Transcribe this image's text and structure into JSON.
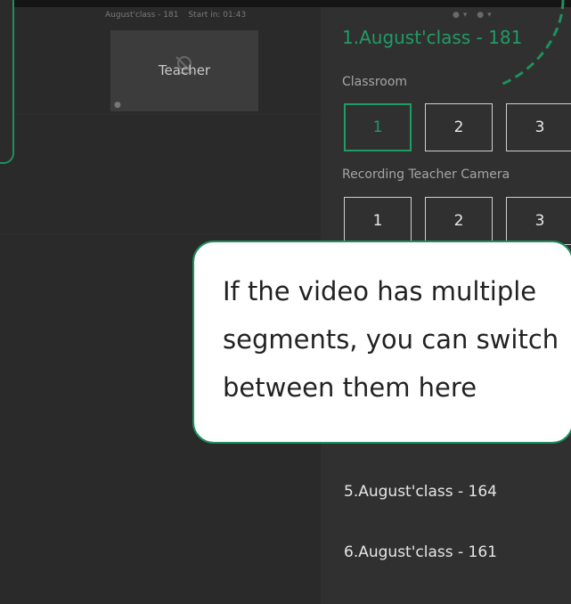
{
  "topbar": {
    "class_name": "August'class - 181",
    "countdown": "Start in: 01:43"
  },
  "video_tile": {
    "label": "Teacher"
  },
  "panel": {
    "current_class": "1.August'class - 181",
    "classroom_label": "Classroom",
    "classroom_buttons": [
      "1",
      "2",
      "3"
    ],
    "recording_label": "Recording Teacher Camera",
    "recording_buttons": [
      "1",
      "2",
      "3"
    ],
    "list": [
      "5.August'class - 164",
      "6.August'class - 161"
    ]
  },
  "tooltip": {
    "lines": [
      "If the video has multiple",
      "segments, you can switch",
      "between them here"
    ]
  },
  "colors": {
    "accent": "#1f9c66",
    "background": "#2d2d2d"
  }
}
